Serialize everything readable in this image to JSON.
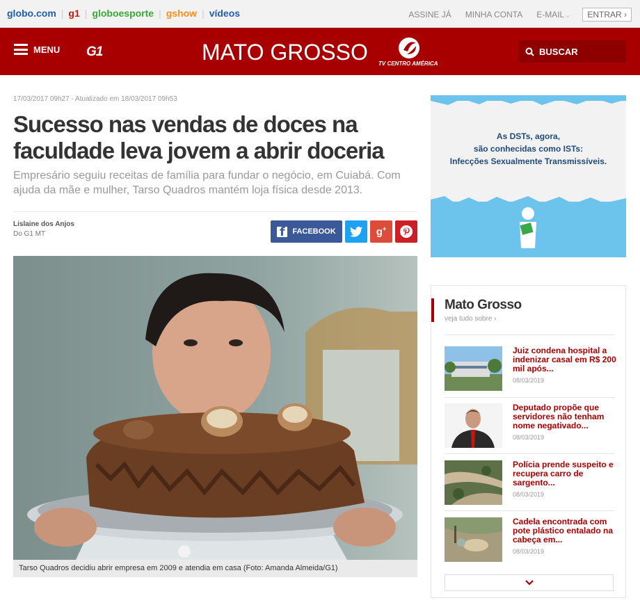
{
  "globo_bar": {
    "sites": [
      "globo.com",
      "g1",
      "globoesporte",
      "gshow",
      "vídeos"
    ],
    "links": [
      "ASSINE JÁ",
      "MINHA CONTA",
      "E-MAIL"
    ],
    "login_label": "ENTRAR"
  },
  "header": {
    "menu_label": "MENU",
    "logo": "G1",
    "region": "MATO GROSSO",
    "affiliate": "TV CENTRO AMÉRICA",
    "search_label": "BUSCAR"
  },
  "article": {
    "dateline": "17/03/2017 09h27 - Atualizado em 18/03/2017 09h53",
    "headline": "Sucesso nas vendas de doces na faculdade leva jovem a abrir doceria",
    "subhead": "Empresário seguiu receitas de família para fundar o negócio, em Cuiabá. Com ajuda da mãe e mulher, Tarso Quadros mantém loja física desde 2013.",
    "author": "Lislaine dos Anjos",
    "source": "Do G1 MT",
    "share": {
      "facebook": "FACEBOOK"
    },
    "photo_caption": "Tarso Quadros decidiu abrir empresa em 2009 e atendia em casa (Foto: Amanda Almeida/G1)"
  },
  "ad": {
    "lines": [
      "As DSTs, agora,",
      "são conhecidas como ISTs:",
      "Infecções Sexualmente Transmissíveis."
    ]
  },
  "sidebar": {
    "title": "Mato Grosso",
    "see_all": "veja tudo sobre ›",
    "items": [
      {
        "title": "Juiz condena hospital a indenizar casal em R$ 200 mil após...",
        "date": "08/03/2019"
      },
      {
        "title": "Deputado propõe que servidores não tenham nome negativado...",
        "date": "08/03/2019"
      },
      {
        "title": "Polícia prende suspeito e recupera carro de sargento...",
        "date": "08/03/2019"
      },
      {
        "title": "Cadela encontrada com pote plástico entalado na cabeça em...",
        "date": "08/03/2019"
      }
    ]
  },
  "colors": {
    "brand_red": "#a80000",
    "facebook": "#3b5998",
    "twitter": "#1da1f2",
    "gplus": "#dd4b39",
    "pinterest": "#cb2027"
  }
}
